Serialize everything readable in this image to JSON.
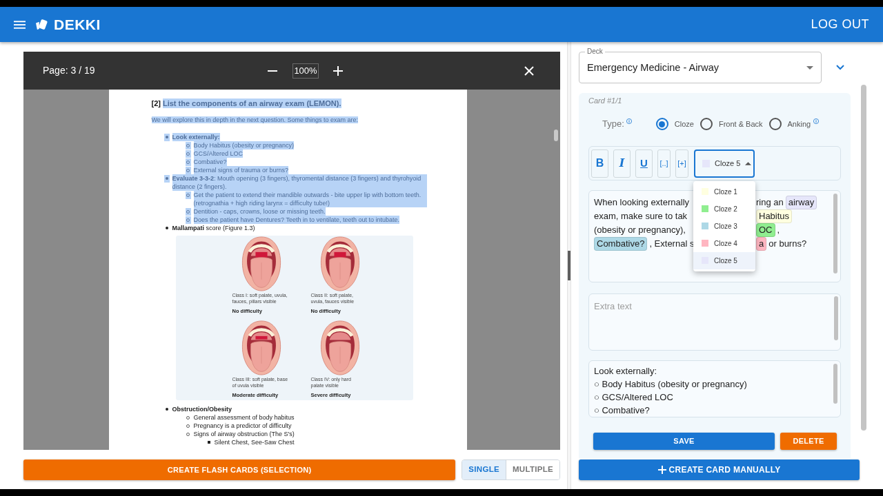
{
  "app_bar": {
    "title": "DEKKI",
    "logout_button": "LOG OUT"
  },
  "pdf_viewer": {
    "page_label": "Page: 3 / 19",
    "zoom": "100%",
    "page": {
      "heading": {
        "number": "[2]",
        "text": "List the components of an airway exam (LEMON).",
        "selected": true
      },
      "intro": {
        "text": "We will explore this in depth in the next question. Some things to exam are:",
        "selected": true
      },
      "items": [
        {
          "text": "**Look externally:**",
          "selected": true,
          "children": [
            {
              "text": "Body Habitus (obesity or pregnancy)",
              "selected": true
            },
            {
              "text": "GCS/Altered LOC",
              "selected": true
            },
            {
              "text": "Combative?",
              "selected": true
            },
            {
              "text": "External signs of trauma or burns?",
              "selected": true
            }
          ]
        },
        {
          "text": "**Evaluate 3-3-2**: Mouth opening (3 fingers), thyromental distance (3 fingers) and thyrohyoid distance (2 fingers).",
          "selected": true,
          "children": [
            {
              "text": "Get the patient to extend their mandible outwards - bite upper lip with bottom teeth. (retrognathia + high riding larynx = difficulty tube!)",
              "selected": true
            },
            {
              "text": "Dentition - caps, crowns, loose or missing teeth.",
              "selected": true
            },
            {
              "text": "Does the patient have Dentures? Teeth in to ventilate, teeth out to intubate.",
              "selected": true
            }
          ]
        },
        {
          "text": "**Mallampati** score (Figure 1.3)",
          "selected": false
        }
      ],
      "figure": {
        "panels": [
          {
            "caption": "Class I: soft palate, uvula,\nfauces, pillars visible",
            "difficulty": "No difficulty"
          },
          {
            "caption": "Class II: soft palate,\nuvula, fauces visible",
            "difficulty": "No difficulty"
          },
          {
            "caption": "Class III: soft palate, base\nof uvula visible",
            "difficulty": "Moderate difficulty"
          },
          {
            "caption": "Class IV: only hard\npalate visible",
            "difficulty": "Severe difficulty"
          }
        ]
      },
      "items_after": [
        {
          "text": "**Obstruction/Obesity**",
          "selected": false,
          "children": [
            {
              "text": "General assessment of body habitus",
              "selected": false
            },
            {
              "text": "Pregnancy is a predictor of difficulty",
              "selected": false
            },
            {
              "text": "Signs of airway obstruction (The S's)",
              "selected": false,
              "children": [
                {
                  "text": "Silent Chest, See-Saw Chest",
                  "selected": false
                }
              ]
            }
          ]
        }
      ]
    }
  },
  "left_actions": {
    "create_button": "CREATE FLASH CARDS (SELECTION)",
    "modes": [
      {
        "label": "SINGLE",
        "selected": true
      },
      {
        "label": "MULTIPLE",
        "selected": false
      }
    ]
  },
  "deck": {
    "label": "Deck",
    "value": "Emergency Medicine - Airway"
  },
  "card": {
    "title": "Card #1/1",
    "type_label": "Type:",
    "type_info": true,
    "types": [
      {
        "label": "Cloze",
        "selected": true,
        "info": false
      },
      {
        "label": "Front & Back",
        "selected": false,
        "info": false
      },
      {
        "label": "Anking",
        "selected": false,
        "info": true
      }
    ],
    "toolbar": [
      {
        "kind": "bold",
        "label": "B"
      },
      {
        "kind": "italic",
        "label": "I"
      },
      {
        "kind": "underline",
        "label": "U"
      },
      {
        "kind": "cloze",
        "label": "[..]"
      },
      {
        "kind": "cloze_add",
        "label": "[+]"
      }
    ],
    "cloze_select": {
      "value": "Cloze 5",
      "color": "#e6e6fa",
      "open": true,
      "options": [
        {
          "label": "Cloze 1",
          "color": "#ffffe0",
          "selected": false
        },
        {
          "label": "Cloze 2",
          "color": "#90ee90",
          "selected": false
        },
        {
          "label": "Cloze 3",
          "color": "#add8e6",
          "selected": false
        },
        {
          "label": "Cloze 4",
          "color": "#ffb6c1",
          "selected": false
        },
        {
          "label": "Cloze 5",
          "color": "#e6e6fa",
          "selected": true
        }
      ]
    },
    "editor": {
      "lines": [
        {
          "left": [
            {
              "kind": "text",
              "text": "When looking externally"
            }
          ],
          "right": [
            {
              "kind": "text",
              "text": "ring an"
            },
            {
              "kind": "cloze",
              "text": "airway",
              "color": "#e6e6fa"
            }
          ]
        },
        {
          "left": [
            {
              "kind": "text",
              "text": "exam, make sure to tak"
            }
          ],
          "right": [
            {
              "kind": "cloze",
              "text": "Habitus",
              "color": "#ffffe0"
            }
          ]
        },
        {
          "left": [
            {
              "kind": "text",
              "text": "(obesity or pregnancy),"
            }
          ],
          "right": [
            {
              "kind": "cloze",
              "text": "OC",
              "color": "#90ee90"
            },
            {
              "kind": "text",
              "text": ","
            }
          ]
        },
        {
          "left": [
            {
              "kind": "cloze",
              "text": "Combative?",
              "color": "#add8e6"
            },
            {
              "kind": "text",
              "text": ", External s"
            }
          ],
          "right": [
            {
              "kind": "cloze",
              "text": "a",
              "color": "#ffb6c1"
            },
            {
              "kind": "text",
              "text": "or burns?"
            }
          ]
        }
      ]
    },
    "extra": {
      "placeholder": "Extra text"
    },
    "source": {
      "lines": [
        "Look externally:",
        "○ Body Habitus (obesity or pregnancy)",
        "○ GCS/Altered LOC",
        "○ Combative?"
      ]
    },
    "save_button": "SAVE",
    "delete_button": "DELETE"
  },
  "create_card_button": "CREATE CARD MANUALLY"
}
